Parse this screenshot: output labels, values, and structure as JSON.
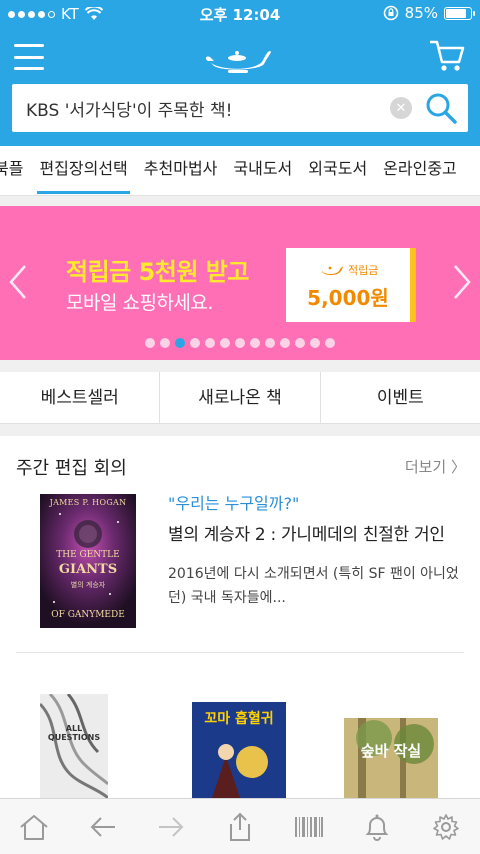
{
  "status_bar": {
    "carrier": "KT",
    "time": "오후 12:04",
    "battery": "85%",
    "battery_level": 0.85
  },
  "header": {
    "logo_icon": "genie-lamp-logo",
    "menu_icon": "menu-icon",
    "cart_icon": "cart-icon",
    "search": {
      "value": "KBS '서가식당'이 주목한 책!",
      "clear_icon": "clear-icon",
      "search_icon": "search-icon"
    }
  },
  "category_tabs": [
    {
      "label": "북플",
      "active": false
    },
    {
      "label": "편집장의선택",
      "active": true
    },
    {
      "label": "추천마법사",
      "active": false
    },
    {
      "label": "국내도서",
      "active": false
    },
    {
      "label": "외국도서",
      "active": false
    },
    {
      "label": "온라인중고",
      "active": false
    }
  ],
  "banner": {
    "headline": "적립금 5천원 받고",
    "sub": "모바일 쇼핑하세요.",
    "point_label": "적립금",
    "point_value": "5,000원",
    "background": "#ff6fb6",
    "dot_count": 13,
    "active_dot": 2
  },
  "subnav": [
    "베스트셀러",
    "새로나온 책",
    "이벤트"
  ],
  "weekly": {
    "title": "주간 편집 회의",
    "more": "더보기 〉",
    "featured": {
      "quote": "\"우리는 누구일까?\"",
      "title": "별의 계승자 2 : 가니메데의 친절한 거인",
      "description": "2016년에 다시 소개되면서 (특히 SF 팬이 아니었던) 국내 독자들에...",
      "cover": {
        "author": "JAMES P. HOGAN",
        "line1": "THE GENTLE",
        "line2": "GIANTS",
        "korean": "별의 계승자",
        "line3": "OF GANYMEDE"
      }
    },
    "more_books": [
      {
        "cover_text": "ALL QUESTIONS"
      },
      {
        "cover_text": "꼬마 흡혈귀"
      },
      {
        "cover_text": "숲바 작실"
      }
    ]
  },
  "toolbar": [
    "home-icon",
    "back-icon",
    "forward-icon",
    "share-icon",
    "barcode-icon",
    "bell-icon",
    "settings-icon"
  ],
  "colors": {
    "brand": "#2aa6e4",
    "accent_orange": "#f18a00",
    "banner_yellow": "#ffe92e"
  }
}
